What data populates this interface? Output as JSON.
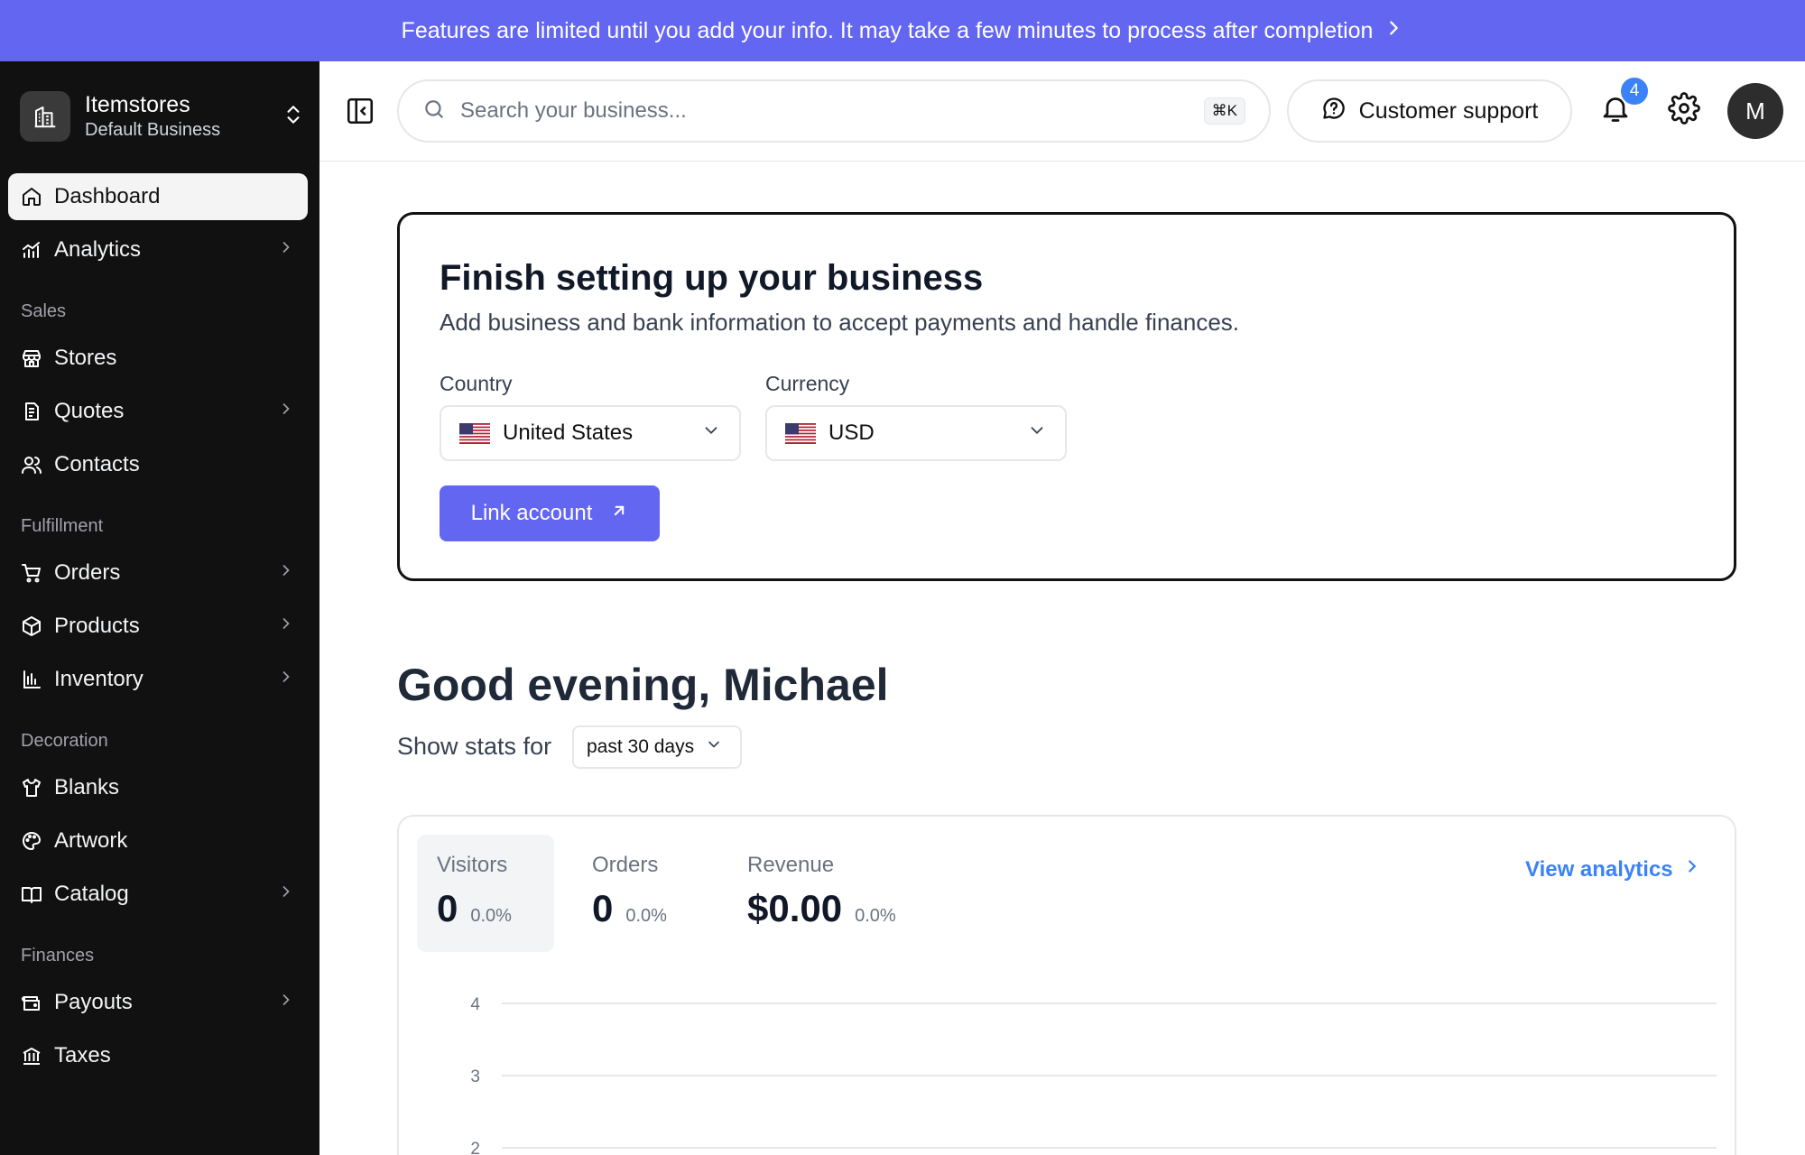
{
  "banner": {
    "text": "Features are limited until you add your info. It may take a few minutes to process after completion"
  },
  "brand": {
    "name": "Itemstores",
    "subtitle": "Default Business"
  },
  "sidebar": {
    "dashboard": "Dashboard",
    "analytics": "Analytics",
    "sales_section": "Sales",
    "stores": "Stores",
    "quotes": "Quotes",
    "contacts": "Contacts",
    "fulfillment_section": "Fulfillment",
    "orders": "Orders",
    "products": "Products",
    "inventory": "Inventory",
    "decoration_section": "Decoration",
    "blanks": "Blanks",
    "artwork": "Artwork",
    "catalog": "Catalog",
    "finances_section": "Finances",
    "payouts": "Payouts",
    "taxes": "Taxes"
  },
  "topbar": {
    "search_placeholder": "Search your business...",
    "search_shortcut": "⌘K",
    "support_label": "Customer support",
    "notification_count": "4",
    "avatar_initial": "M"
  },
  "setup": {
    "title": "Finish setting up your business",
    "subtitle": "Add business and bank information to accept payments and handle finances.",
    "country_label": "Country",
    "country_value": "United States",
    "currency_label": "Currency",
    "currency_value": "USD",
    "link_button": "Link account"
  },
  "greeting": "Good evening, Michael",
  "stats": {
    "label": "Show stats for",
    "range": "past 30 days",
    "view_analytics": "View analytics",
    "metrics": [
      {
        "label": "Visitors",
        "value": "0",
        "change": "0.0%"
      },
      {
        "label": "Orders",
        "value": "0",
        "change": "0.0%"
      },
      {
        "label": "Revenue",
        "value": "$0.00",
        "change": "0.0%"
      }
    ]
  },
  "chart_data": {
    "type": "line",
    "x": [],
    "series": [],
    "yticks": [
      4,
      3,
      2
    ],
    "ylim": [
      2,
      4
    ],
    "grid": true
  },
  "colors": {
    "accent": "#6366f1",
    "link": "#3b82f6",
    "sidebar_bg": "#111111"
  }
}
